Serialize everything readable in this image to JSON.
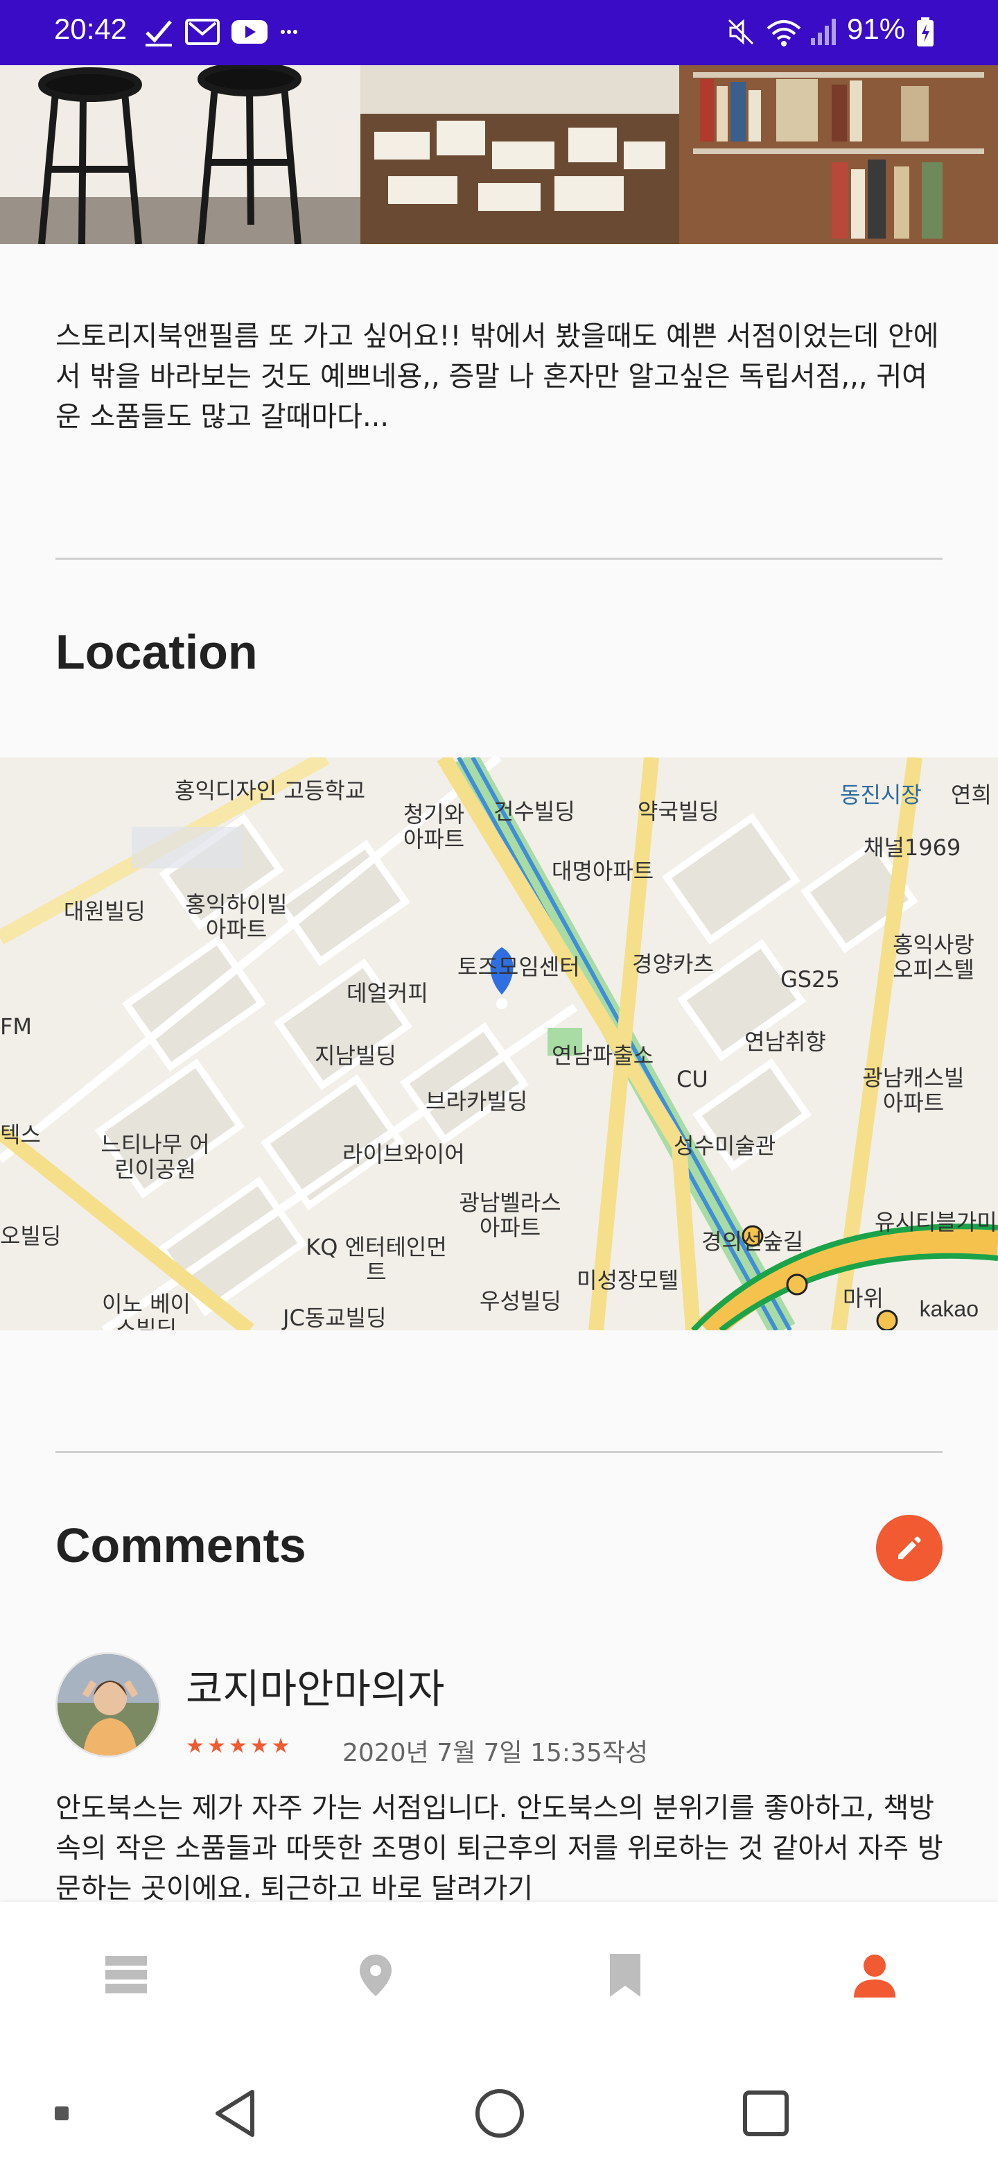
{
  "status_bar": {
    "time": "20:42",
    "battery": "91%",
    "icons_left": [
      "check-icon",
      "gmail-icon",
      "youtube-icon",
      "more-dots-icon"
    ],
    "icons_right": [
      "mute-icon",
      "wifi-icon",
      "signal-icon",
      "battery-icon"
    ]
  },
  "review": {
    "text": "스토리지북앤필름 또 가고 싶어요!! 밖에서 봤을때도 예쁜 서점이었는데 안에서 밖을 바라보는 것도 예쁘네용,, 증말 나 혼자만 알고싶은 독립서점,,, 귀여운 소품들도 많고 갈때마다..."
  },
  "location": {
    "title": "Location",
    "map_labels": [
      "홍익디자인 고등학교",
      "청기와 아파트",
      "건수빌딩",
      "약국빌딩",
      "동진시장",
      "연희",
      "채널1969",
      "대명아파트",
      "대원빌딩",
      "홍익하이빌 아파트",
      "토즈모임센터",
      "경양카츠",
      "GS25",
      "홍익사랑 오피스텔",
      "데얼커피",
      "지남빌딩",
      "연남파출소",
      "연남취향",
      "CU",
      "브라카빌딩",
      "광남캐스빌 아파트",
      "느티나무 어린이공원",
      "라이브와이어",
      "성수미술관",
      "광남벨라스 아파트",
      "유시티블가미",
      "KQ 엔터테인먼트",
      "미성장모텔",
      "경의선숲길",
      "이노 베이스빌딩",
      "JC동교빌딩",
      "우성빌딩",
      "FM",
      "텍스",
      "오빌딩",
      "마위"
    ],
    "attribution": "kakao"
  },
  "comments": {
    "title": "Comments",
    "items": [
      {
        "author": "코지마안마의자",
        "rating": 5,
        "date": "2020년 7월 7일 15:35작성",
        "text": "안도북스는 제가 자주 가는 서점입니다. 안도북스의 분위기를 좋아하고, 책방 속의 작은 소품들과 따뜻한 조명이 퇴근후의 저를 위로하는 것 같아서 자주 방문하는 곳이에요. 퇴근하고 바로 달려가기"
      }
    ]
  },
  "bottom_nav": {
    "items": [
      "feed-icon",
      "location-pin-icon",
      "bookmark-icon",
      "profile-icon"
    ],
    "active_index": 3
  },
  "colors": {
    "status_bar": "#3a0cc6",
    "accent": "#f25a31",
    "inactive_icon": "#bdbdbd"
  }
}
